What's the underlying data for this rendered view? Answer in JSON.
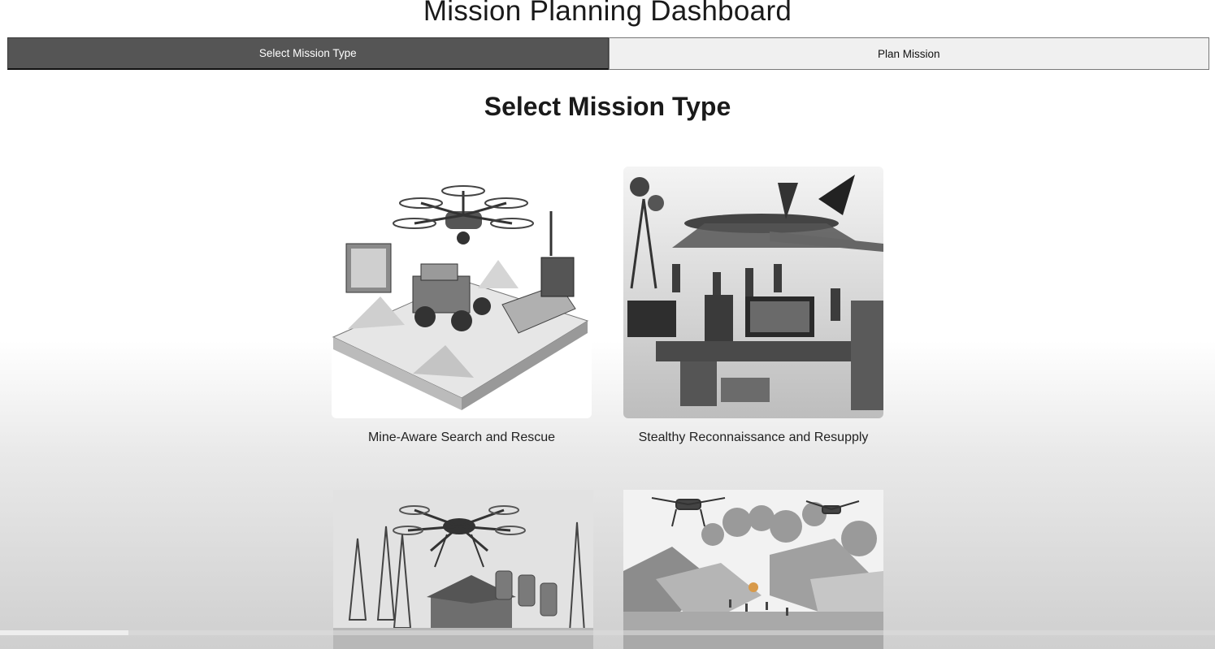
{
  "app": {
    "title": "Mission Planning Dashboard"
  },
  "tabs": [
    {
      "label": "Select Mission Type",
      "active": true
    },
    {
      "label": "Plan Mission",
      "active": false
    }
  ],
  "section": {
    "heading": "Select Mission Type"
  },
  "missions": [
    {
      "caption": "Mine-Aware Search and Rescue",
      "image": "drone-terrain-illustration"
    },
    {
      "caption": "Stealthy Reconnaissance and Resupply",
      "image": "uav-command-post-illustration"
    },
    {
      "caption": "",
      "image": "hexacopter-comm-towers-illustration"
    },
    {
      "caption": "",
      "image": "drones-over-disaster-zone-illustration"
    }
  ],
  "colors": {
    "tab_active_bg": "#555555",
    "tab_inactive_bg": "#f0f0f0"
  }
}
